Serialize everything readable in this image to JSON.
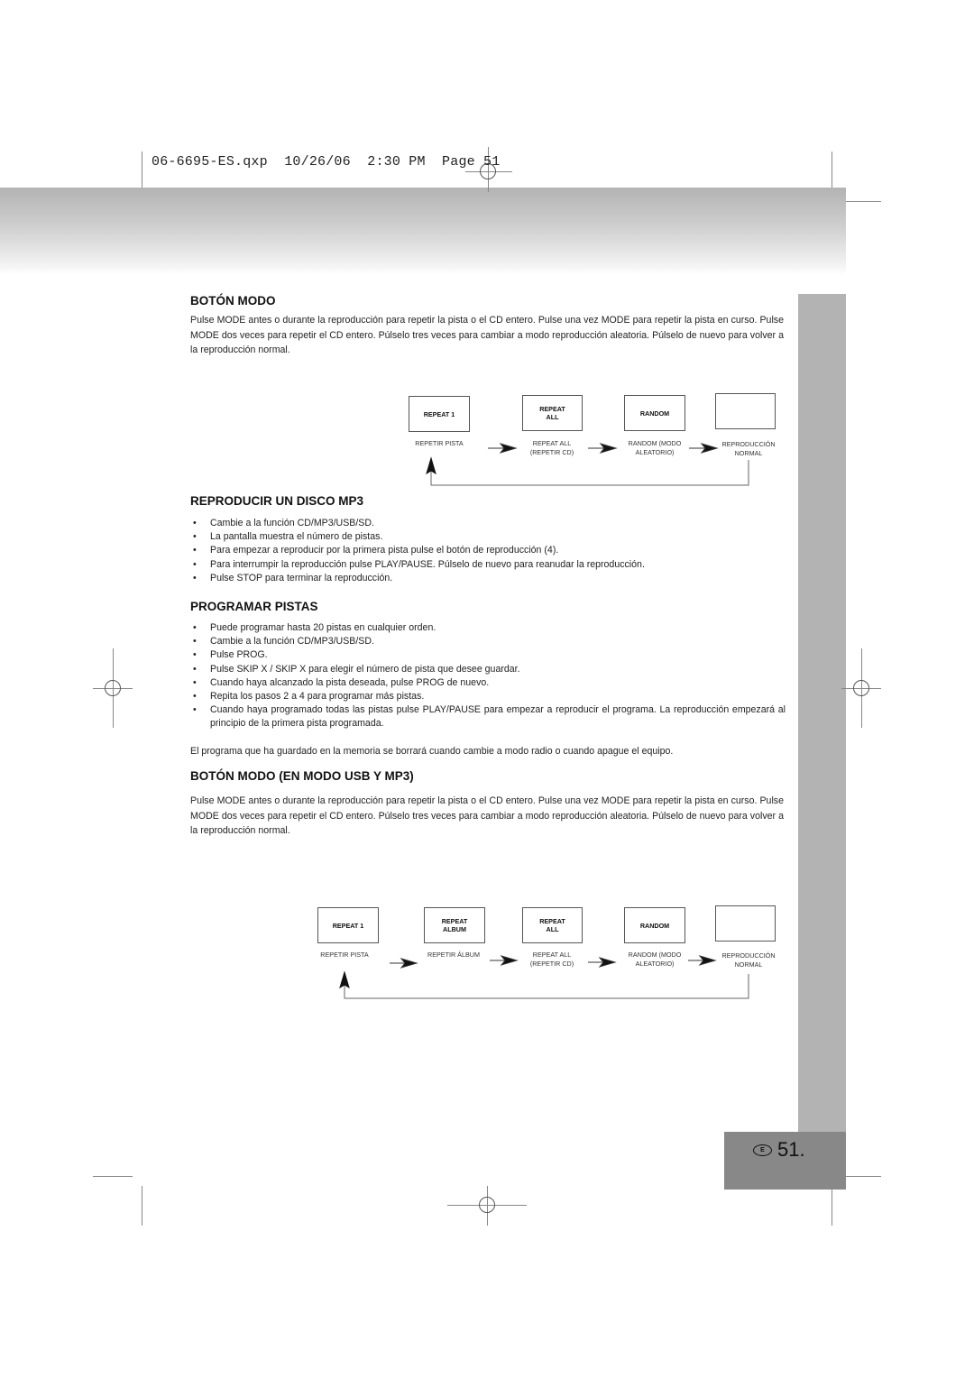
{
  "slug": "06-6695-ES.qxp  10/26/06  2:30 PM  Page 51",
  "sections": {
    "boton_modo": {
      "title": "BOTÓN MODO",
      "body": "Pulse MODE antes o durante la reproducción para repetir la pista o el CD entero. Pulse una vez MODE para repetir la pista en curso. Pulse MODE dos veces para repetir el CD entero. Púlselo tres veces para cambiar a modo reproducción aleatoria. Púlselo de nuevo para volver a la reproducción normal.",
      "diagram": {
        "boxes": [
          "REPEAT 1",
          "REPEAT\nALL",
          "RANDOM",
          ""
        ],
        "captions": [
          "REPETIR PISTA",
          "REPEAT ALL\n(REPETIR CD)",
          "RANDOM (MODO\nALEATORIO)",
          "REPRODUCCIÓN\nNORMAL"
        ]
      }
    },
    "reproducir_mp3": {
      "title": "REPRODUCIR UN DISCO MP3",
      "items": [
        "Cambie a la función CD/MP3/USB/SD.",
        "La pantalla muestra el número de pistas.",
        "Para empezar a reproducir por la primera pista pulse el botón de reproducción (4).",
        "Para interrumpir la reproducción pulse PLAY/PAUSE. Púlselo de nuevo para reanudar la reproducción.",
        "Pulse STOP para terminar la reproducción."
      ]
    },
    "programar": {
      "title": "PROGRAMAR PISTAS",
      "items": [
        "Puede programar hasta 20 pistas en cualquier orden.",
        "Cambie a la función CD/MP3/USB/SD.",
        "Pulse PROG.",
        "Pulse SKIP X / SKIP X para elegir el número de pista que desee guardar.",
        "Cuando haya alcanzado la pista deseada, pulse PROG de nuevo.",
        "Repita los pasos 2 a 4 para programar más pistas.",
        "Cuando haya programado todas las pistas pulse PLAY/PAUSE para empezar a reproducir el programa. La reproducción empezará al principio de la primera pista programada."
      ],
      "note": "El programa que ha guardado en la memoria se borrará cuando cambie a modo radio o cuando apague el equipo."
    },
    "boton_modo_usb": {
      "title": "BOTÓN MODO (EN MODO USB Y MP3)",
      "body": "Pulse MODE antes o durante la reproducción para repetir la pista o el CD entero. Pulse una vez MODE para repetir la pista en curso. Pulse MODE dos veces para repetir el CD entero. Púlselo tres veces para cambiar a modo reproducción aleatoria. Púlselo de nuevo para volver a la reproducción normal.",
      "diagram": {
        "boxes": [
          "REPEAT 1",
          "REPEAT\nALBUM",
          "REPEAT\nALL",
          "RANDOM",
          ""
        ],
        "captions": [
          "REPETIR PISTA",
          "REPETIR ÁLBUM",
          "REPEAT ALL\n(REPETIR CD)",
          "RANDOM (MODO\nALEATORIO)",
          "REPRODUCCIÓN\nNORMAL"
        ]
      }
    }
  },
  "footer": {
    "lang_badge": "E",
    "page_number": "51."
  }
}
